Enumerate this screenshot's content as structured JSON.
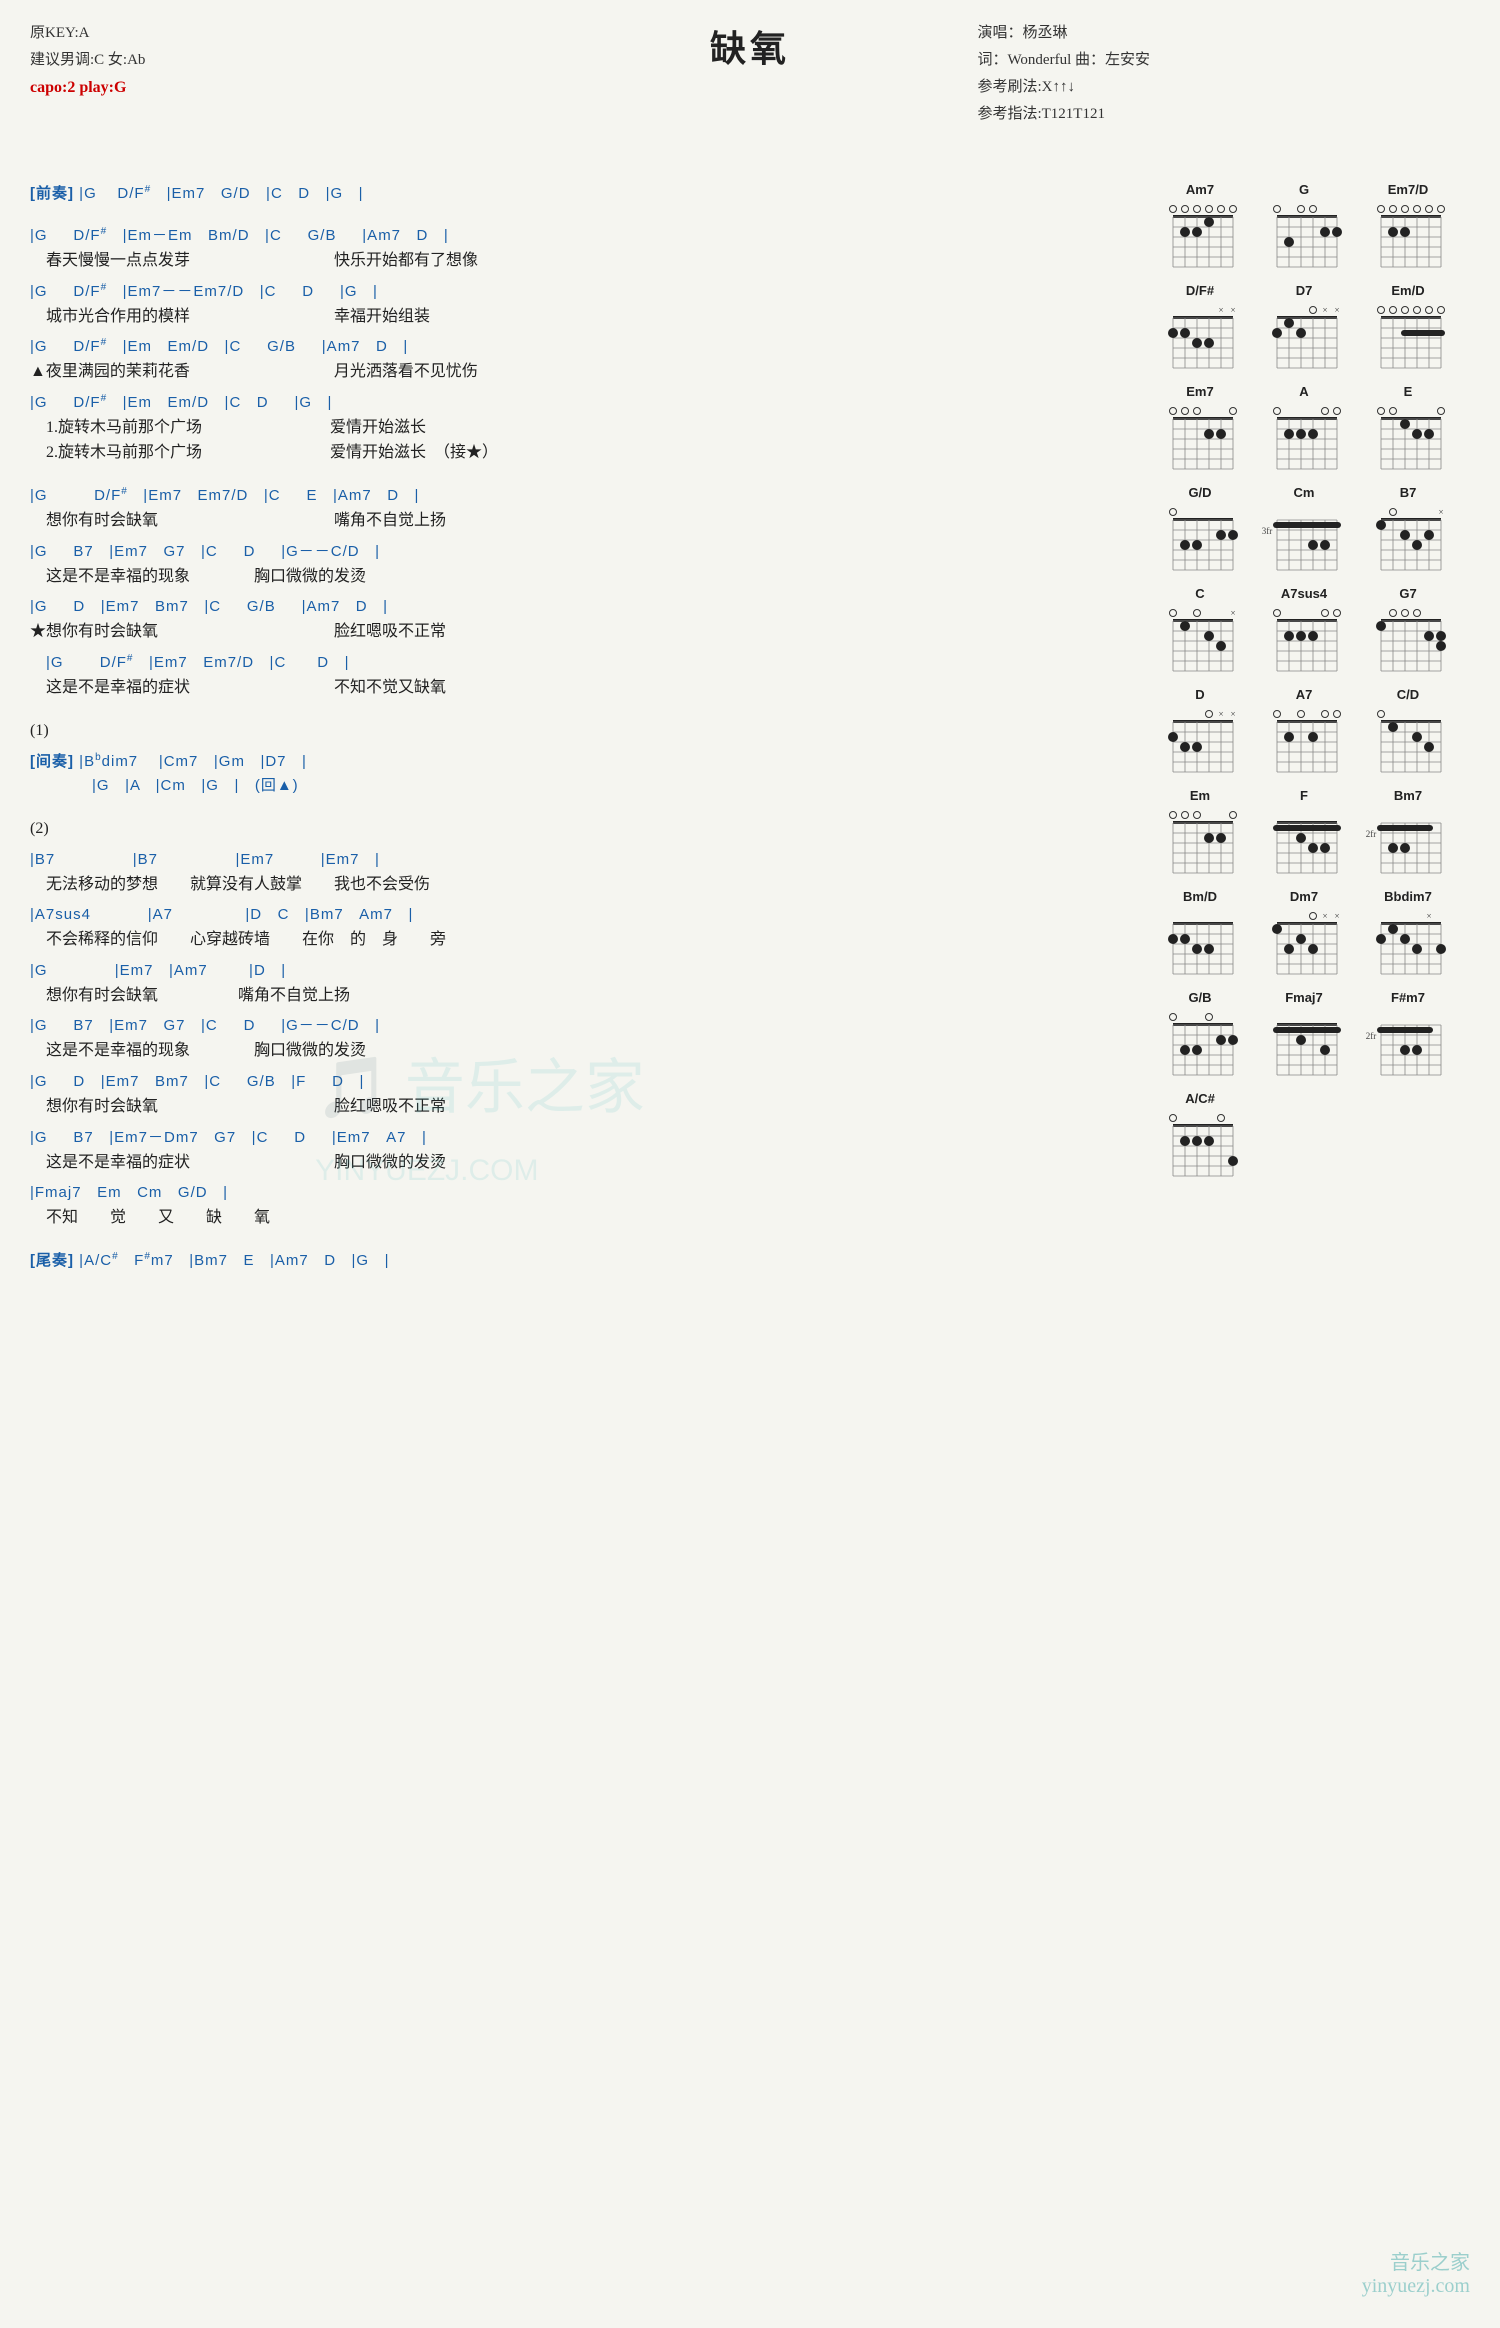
{
  "title": "缺氧",
  "meta": {
    "original_key": "原KEY:A",
    "suggested_key": "建议男调:C 女:Ab",
    "capo": "capo:2 play:G",
    "singer": "演唱：杨丞琳",
    "words": "词：Wonderful  曲：左安安",
    "strum": "参考刷法:X↑↑↓",
    "finger": "参考指法:T121T121"
  },
  "watermark": "音乐之家\nYINYUEZJ.COM",
  "watermark_bottom": "音乐之家\nyinyuezj.com",
  "chords": [
    {
      "name": "Am7",
      "fret_start": 0,
      "dots": [
        [
          1,
          1
        ],
        [
          1,
          2
        ],
        [
          2,
          3
        ],
        [
          2,
          4
        ]
      ],
      "open": [
        1,
        2,
        3,
        4,
        5,
        6
      ],
      "muted": []
    },
    {
      "name": "G",
      "fret_start": 0,
      "dots": [
        [
          2,
          5
        ],
        [
          2,
          6
        ],
        [
          3,
          2
        ]
      ],
      "open": [
        1,
        3,
        4
      ],
      "muted": []
    },
    {
      "name": "Em7/D",
      "fret_start": 0,
      "dots": [
        [
          2,
          1
        ],
        [
          2,
          2
        ]
      ],
      "open": [
        3,
        4,
        5,
        6
      ],
      "muted": []
    },
    {
      "name": "D/F#",
      "fret_start": 0,
      "dots": [
        [
          2,
          1
        ],
        [
          3,
          2
        ],
        [
          4,
          3
        ],
        [
          4,
          4
        ]
      ],
      "open": [],
      "muted": [
        5,
        6
      ]
    },
    {
      "name": "D7",
      "fret_start": 0,
      "dots": [
        [
          2,
          1
        ],
        [
          2,
          3
        ],
        [
          3,
          2
        ]
      ],
      "open": [
        4
      ],
      "muted": [
        5,
        6
      ]
    },
    {
      "name": "Em/D",
      "fret_start": 0,
      "dots": [
        [
          2,
          3
        ],
        [
          2,
          4
        ],
        [
          2,
          5
        ],
        [
          2,
          6
        ]
      ],
      "open": [
        1,
        2
      ],
      "muted": []
    },
    {
      "name": "Em7",
      "fret_start": 0,
      "dots": [
        [
          2,
          4
        ],
        [
          2,
          5
        ]
      ],
      "open": [
        1,
        2,
        3,
        6
      ],
      "muted": []
    },
    {
      "name": "A",
      "fret_start": 0,
      "dots": [
        [
          2,
          2
        ],
        [
          2,
          3
        ],
        [
          2,
          4
        ]
      ],
      "open": [
        1,
        5,
        6
      ],
      "muted": []
    },
    {
      "name": "E",
      "fret_start": 0,
      "dots": [
        [
          1,
          3
        ],
        [
          2,
          4
        ],
        [
          2,
          5
        ]
      ],
      "open": [
        1,
        2,
        6
      ],
      "muted": []
    },
    {
      "name": "G/D",
      "fret_start": 0,
      "dots": [
        [
          2,
          5
        ],
        [
          2,
          6
        ],
        [
          3,
          2
        ],
        [
          3,
          3
        ]
      ],
      "open": [
        1
      ],
      "muted": []
    },
    {
      "name": "Cm",
      "fret_start": 3,
      "dots": [
        [
          1,
          1
        ],
        [
          1,
          2
        ],
        [
          1,
          3
        ],
        [
          1,
          4
        ],
        [
          1,
          5
        ],
        [
          1,
          6
        ],
        [
          3,
          4
        ],
        [
          3,
          5
        ]
      ],
      "open": [],
      "muted": []
    },
    {
      "name": "B7",
      "fret_start": 0,
      "dots": [
        [
          1,
          1
        ],
        [
          2,
          3
        ],
        [
          2,
          5
        ],
        [
          3,
          4
        ]
      ],
      "open": [
        2
      ],
      "muted": [
        6
      ]
    },
    {
      "name": "C",
      "fret_start": 0,
      "dots": [
        [
          1,
          2
        ],
        [
          2,
          4
        ],
        [
          3,
          5
        ]
      ],
      "open": [
        1,
        3
      ],
      "muted": [
        6
      ]
    },
    {
      "name": "A7sus4",
      "fret_start": 0,
      "dots": [
        [
          2,
          2
        ],
        [
          2,
          3
        ],
        [
          2,
          4
        ]
      ],
      "open": [
        1,
        5,
        6
      ],
      "muted": []
    },
    {
      "name": "G7",
      "fret_start": 0,
      "dots": [
        [
          1,
          1
        ],
        [
          2,
          5
        ],
        [
          2,
          6
        ],
        [
          3,
          6
        ]
      ],
      "open": [
        2,
        3,
        4
      ],
      "muted": []
    },
    {
      "name": "D",
      "fret_start": 0,
      "dots": [
        [
          2,
          1
        ],
        [
          3,
          2
        ],
        [
          3,
          3
        ]
      ],
      "open": [
        4
      ],
      "muted": [
        5,
        6
      ]
    },
    {
      "name": "A7",
      "fret_start": 0,
      "dots": [
        [
          2,
          2
        ],
        [
          2,
          4
        ]
      ],
      "open": [
        1,
        3,
        5,
        6
      ],
      "muted": []
    },
    {
      "name": "C/D",
      "fret_start": 0,
      "dots": [
        [
          1,
          2
        ],
        [
          2,
          4
        ],
        [
          3,
          5
        ]
      ],
      "open": [
        1
      ],
      "muted": []
    },
    {
      "name": "Em",
      "fret_start": 0,
      "dots": [
        [
          2,
          4
        ],
        [
          2,
          5
        ]
      ],
      "open": [
        1,
        2,
        3,
        6
      ],
      "muted": []
    },
    {
      "name": "F",
      "fret_start": 1,
      "dots": [
        [
          1,
          1
        ],
        [
          1,
          2
        ],
        [
          1,
          3
        ],
        [
          1,
          4
        ],
        [
          1,
          5
        ],
        [
          1,
          6
        ],
        [
          2,
          3
        ],
        [
          3,
          4
        ],
        [
          3,
          5
        ]
      ],
      "open": [],
      "muted": []
    },
    {
      "name": "Bm7",
      "fret_start": 2,
      "dots": [
        [
          1,
          1
        ],
        [
          1,
          2
        ],
        [
          1,
          3
        ],
        [
          1,
          4
        ],
        [
          1,
          5
        ],
        [
          3,
          2
        ],
        [
          3,
          3
        ]
      ],
      "open": [],
      "muted": []
    },
    {
      "name": "Bm/D",
      "fret_start": 0,
      "dots": [
        [
          2,
          1
        ],
        [
          3,
          2
        ],
        [
          4,
          3
        ],
        [
          4,
          4
        ]
      ],
      "open": [],
      "muted": []
    },
    {
      "name": "Dm7",
      "fret_start": 0,
      "dots": [
        [
          1,
          1
        ],
        [
          2,
          3
        ],
        [
          3,
          2
        ],
        [
          3,
          4
        ]
      ],
      "open": [
        4
      ],
      "muted": [
        5,
        6
      ]
    },
    {
      "name": "Bbdim7",
      "fret_start": 0,
      "dots": [
        [
          1,
          2
        ],
        [
          2,
          1
        ],
        [
          2,
          3
        ],
        [
          3,
          4
        ],
        [
          3,
          6
        ]
      ],
      "open": [],
      "muted": [
        5
      ]
    },
    {
      "name": "G/B",
      "fret_start": 0,
      "dots": [
        [
          2,
          5
        ],
        [
          2,
          6
        ],
        [
          3,
          2
        ],
        [
          3,
          3
        ]
      ],
      "open": [
        1,
        4
      ],
      "muted": []
    },
    {
      "name": "Fmaj7",
      "fret_start": 0,
      "dots": [
        [
          1,
          1
        ],
        [
          1,
          2
        ],
        [
          1,
          3
        ],
        [
          1,
          4
        ],
        [
          1,
          5
        ],
        [
          1,
          6
        ],
        [
          2,
          3
        ],
        [
          3,
          5
        ]
      ],
      "open": [],
      "muted": []
    },
    {
      "name": "F#m7",
      "fret_start": 2,
      "dots": [
        [
          1,
          1
        ],
        [
          1,
          2
        ],
        [
          1,
          3
        ],
        [
          1,
          4
        ],
        [
          1,
          5
        ],
        [
          3,
          3
        ],
        [
          3,
          4
        ]
      ],
      "open": [],
      "muted": []
    },
    {
      "name": "A/C#",
      "fret_start": 0,
      "dots": [
        [
          2,
          2
        ],
        [
          2,
          3
        ],
        [
          2,
          4
        ],
        [
          4,
          6
        ]
      ],
      "open": [
        1,
        5
      ],
      "muted": []
    }
  ]
}
